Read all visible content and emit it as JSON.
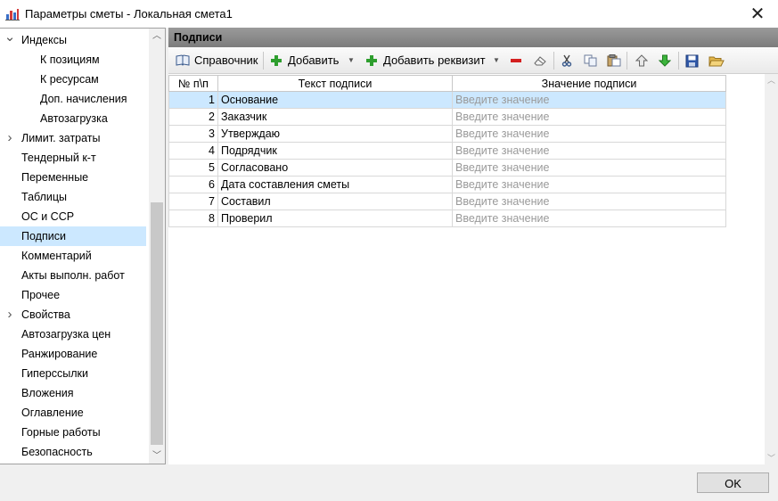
{
  "window": {
    "title": "Параметры сметы - Локальная смета1",
    "close_glyph": "✕",
    "icon": "chart-app-icon"
  },
  "tree": {
    "items": [
      {
        "label": "Индексы",
        "level": 0,
        "expander": "expanded"
      },
      {
        "label": "К позициям",
        "level": 1
      },
      {
        "label": "К ресурсам",
        "level": 1
      },
      {
        "label": "Доп. начисления",
        "level": 1
      },
      {
        "label": "Автозагрузка",
        "level": 1
      },
      {
        "label": "Лимит. затраты",
        "level": 0,
        "expander": "collapsed"
      },
      {
        "label": "Тендерный к-т",
        "level": 0
      },
      {
        "label": "Переменные",
        "level": 0
      },
      {
        "label": "Таблицы",
        "level": 0
      },
      {
        "label": "ОС и ССР",
        "level": 0
      },
      {
        "label": "Подписи",
        "level": 0,
        "selected": true
      },
      {
        "label": "Комментарий",
        "level": 0
      },
      {
        "label": "Акты выполн. работ",
        "level": 0
      },
      {
        "label": "Прочее",
        "level": 0
      },
      {
        "label": "Свойства",
        "level": 0,
        "expander": "collapsed"
      },
      {
        "label": "Автозагрузка цен",
        "level": 0
      },
      {
        "label": "Ранжирование",
        "level": 0
      },
      {
        "label": "Гиперссылки",
        "level": 0
      },
      {
        "label": "Вложения",
        "level": 0
      },
      {
        "label": "Оглавление",
        "level": 0
      },
      {
        "label": "Горные работы",
        "level": 0
      },
      {
        "label": "Безопасность",
        "level": 0
      }
    ]
  },
  "panel": {
    "title": "Подписи",
    "toolbar": {
      "reference_label": "Справочник",
      "add_label": "Добавить",
      "add_attribute_label": "Добавить реквизит"
    },
    "grid": {
      "columns": [
        "№ п\\п",
        "Текст подписи",
        "Значение подписи"
      ],
      "rows": [
        {
          "num": "1",
          "text": "Основание",
          "value": "Введите значение"
        },
        {
          "num": "2",
          "text": "Заказчик",
          "value": "Введите значение"
        },
        {
          "num": "3",
          "text": "Утверждаю",
          "value": "Введите значение"
        },
        {
          "num": "4",
          "text": "Подрядчик",
          "value": "Введите значение"
        },
        {
          "num": "5",
          "text": "Согласовано",
          "value": "Введите значение"
        },
        {
          "num": "6",
          "text": "Дата составления сметы",
          "value": "Введите значение"
        },
        {
          "num": "7",
          "text": "Составил",
          "value": "Введите значение"
        },
        {
          "num": "8",
          "text": "Проверил",
          "value": "Введите значение"
        }
      ],
      "selected_row": 0
    }
  },
  "footer": {
    "ok_label": "OK"
  },
  "colors": {
    "selection": "#cce8ff",
    "panel_header": "#8a8a8a",
    "add_green": "#2e9e2e",
    "remove_red": "#d42020"
  }
}
